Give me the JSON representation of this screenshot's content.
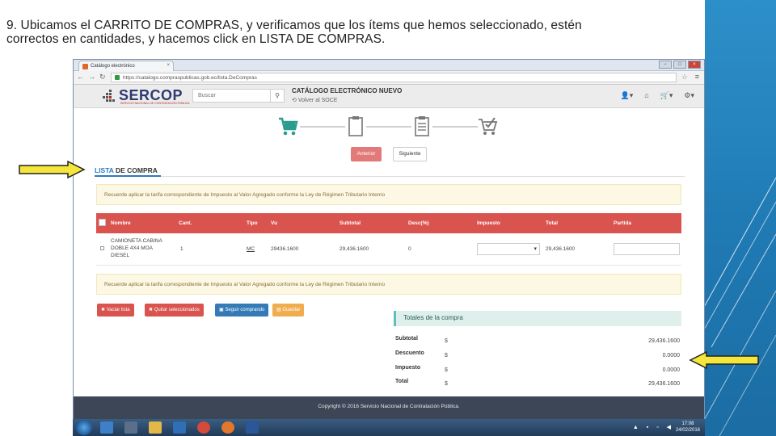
{
  "slide": {
    "instruction_line1": "9. Ubicamos el CARRITO DE COMPRAS, y verificamos que los ítems que hemos seleccionado, estén",
    "instruction_line2": "correctos en cantidades, y hacemos click en LISTA DE COMPRAS.",
    "accent_color": "#2d8fc9",
    "arrow_color": "#f5e63b"
  },
  "browser": {
    "tab_title": "Catálogo electrónico",
    "url": "https://catalogo.compraspublicas.gob.ec/lista.DeCompras",
    "win_min": "−",
    "win_max": "□",
    "win_close": "×"
  },
  "header": {
    "logo_text": "SERCOP",
    "logo_subtitle": "SERVICIO NACIONAL DE CONTRATACIÓN PÚBLICA",
    "search_placeholder": "Buscar",
    "catalog_title": "CATÁLOGO ELECTRÓNICO NUEVO",
    "back_link": "Volver al SOCE",
    "icons": [
      "user-icon",
      "home-icon",
      "cart-icon",
      "gear-icon"
    ]
  },
  "wizard": {
    "steps": [
      "cart-icon",
      "clipboard-icon",
      "list-icon",
      "cart-check-icon"
    ],
    "prev_label": "Anterior",
    "next_label": "Siguiente"
  },
  "section": {
    "title_blue": "LISTA",
    "title_rest": " DE COMPRA"
  },
  "notice_text": "Recuerde aplicar la tarifa correspondiente de Impuesto al Valor Agregado conforme la Ley de Régimen Tributario Interno",
  "table": {
    "headers": [
      "Nombre",
      "Cant.",
      "Tipo",
      "Vu",
      "Subtotal",
      "Desc(%)",
      "Impuesto",
      "Total",
      "Partida"
    ],
    "rows": [
      {
        "nombre_line1": "CAMIONETA CABINA",
        "nombre_line2": "DOBLE 4X4 MOA",
        "nombre_line3": "DIESEL",
        "cant": "1",
        "tipo": "MC",
        "vu": "29436.1600",
        "subtotal": "29,436.1600",
        "desc": "0",
        "impuesto": "",
        "total": "29,436.1600",
        "partida": ""
      }
    ]
  },
  "actions": {
    "vaciar": "Vaciar lista",
    "quitar": "Quitar seleccionados",
    "seguir": "Seguir comprando",
    "guardar": "Guardar"
  },
  "totals": {
    "title": "Totales de la compra",
    "currency": "$",
    "rows": [
      {
        "label": "Subtotal",
        "value": "29,436.1600"
      },
      {
        "label": "Descuento",
        "value": "0.0000"
      },
      {
        "label": "Impuesto",
        "value": "0.0000"
      },
      {
        "label": "Total",
        "value": "29,436.1600"
      }
    ]
  },
  "footer_text": "Copyright © 2016 Servicio Nacional de Contratación Pública.",
  "taskbar": {
    "time": "17:08",
    "date": "24/02/2016",
    "icons": [
      "start-icon",
      "ie-icon",
      "media-icon",
      "folder-icon",
      "player-icon",
      "chrome-icon",
      "firefox-icon",
      "word-icon"
    ]
  }
}
